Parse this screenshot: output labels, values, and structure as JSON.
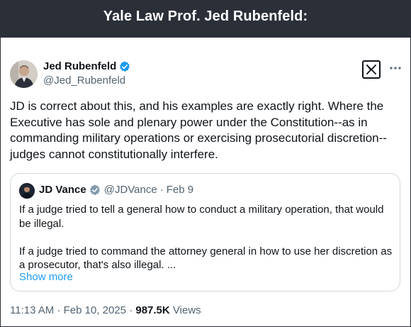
{
  "banner": {
    "title": "Yale Law Prof. Jed Rubenfeld:"
  },
  "post": {
    "author_name": "Jed Rubenfeld",
    "author_handle": "@Jed_Rubenfeld",
    "text": "JD is correct about this, and his examples are exactly right.  Where the\nExecutive has sole and plenary power under the Constitution--as in\ncommanding military operations or exercising prosecutorial discretion--\njudges cannot constitutionally interfere.",
    "time": "11:13 AM",
    "date": "Feb 10, 2025",
    "views_count": "987.5K",
    "views_label": "Views"
  },
  "quote": {
    "author_name": "JD Vance",
    "author_handle": "@JDVance",
    "date": "Feb 9",
    "paragraph1": "If a judge tried to tell a general how to conduct a military operation, that would be illegal.",
    "paragraph2": "If a judge tried to command the attorney general in how to use her discretion as a prosecutor, that's also illegal. ...",
    "show_more": "Show more"
  },
  "icons": {
    "verified": "verified-badge-icon",
    "x_logo": "x-logo-icon",
    "more": "more-options-icon"
  },
  "colors": {
    "banner_bg": "#2b3038",
    "verified_blue": "#1d9bf0",
    "link_blue": "#1d9bf0",
    "muted_text": "#536471"
  }
}
